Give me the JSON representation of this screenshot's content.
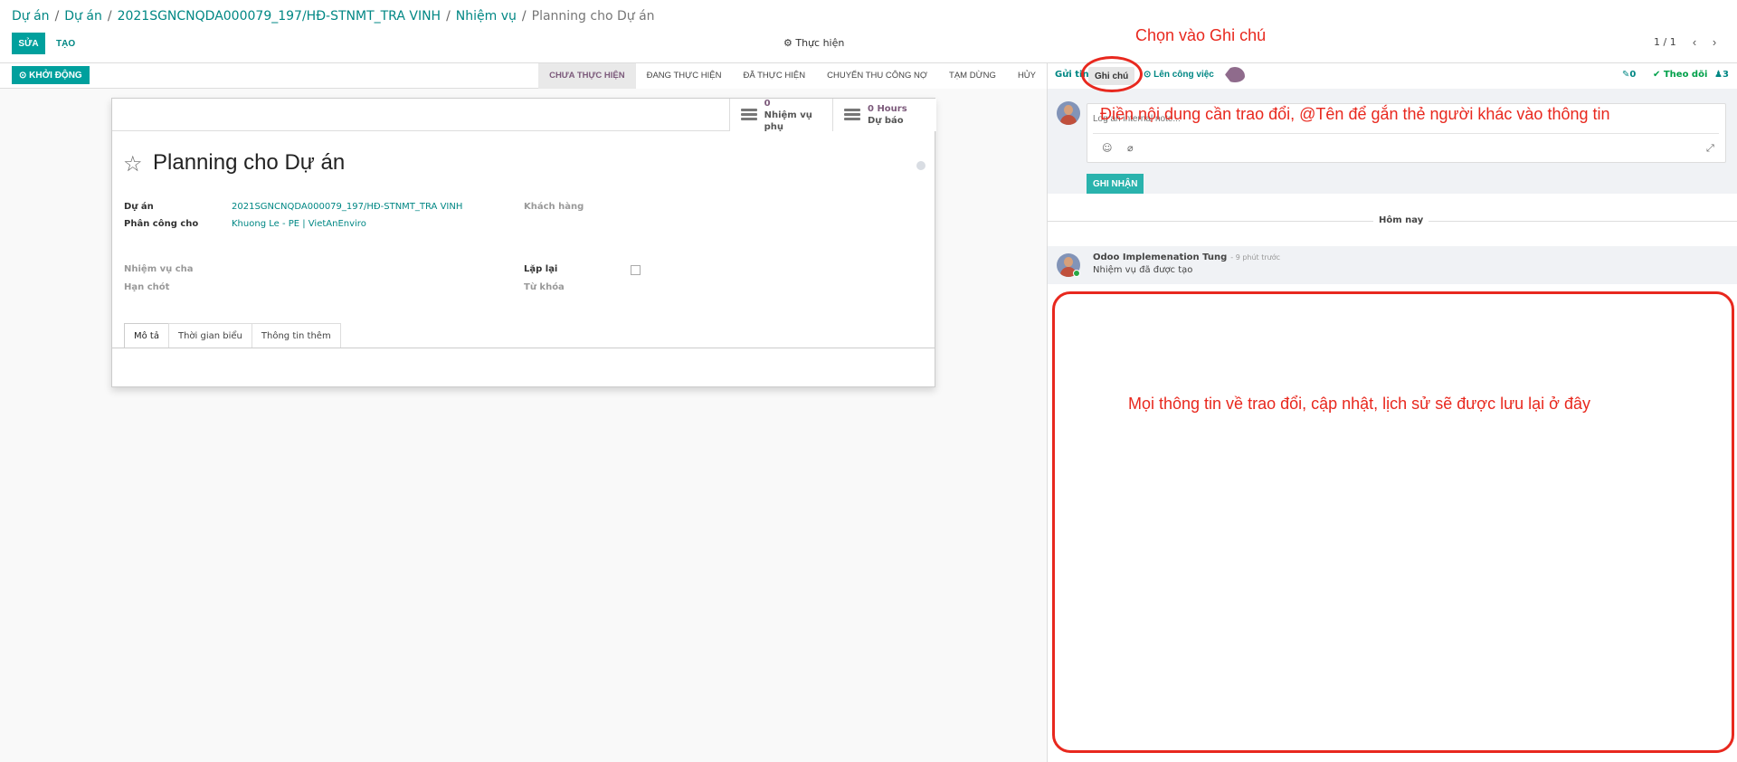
{
  "breadcrumb": {
    "items": [
      "Dự án",
      "Dự án",
      "2021SGNCNQDA000079_197/HĐ-STNMT_TRA VINH",
      "Nhiệm vụ"
    ],
    "current": "Planning cho Dự án"
  },
  "toolbar": {
    "edit_label": "SỬA",
    "create_label": "TẠO",
    "action_label": "⚙ Thực hiện",
    "pager": "1 / 1"
  },
  "statusbar": {
    "start_label": "⊙ KHỞI ĐỘNG",
    "stages": [
      "CHƯA THỰC HIỆN",
      "ĐANG THỰC HIỆN",
      "ĐÃ THỰC HIỆN",
      "CHUYỂN THU CÔNG NỢ",
      "TẠM DỪNG",
      "HỦY"
    ],
    "active_stage": "CHƯA THỰC HIỆN"
  },
  "stats": {
    "subtasks_value": "0",
    "subtasks_label": "Nhiệm vụ phụ",
    "forecast_value": "0  Hours",
    "forecast_label": "Dự báo"
  },
  "form": {
    "title": "Planning cho Dự án",
    "project_label": "Dự án",
    "project_value": "2021SGNCNQDA000079_197/HĐ-STNMT_TRA VINH",
    "assignee_label": "Phân công cho",
    "assignee_value": "Khuong Le - PE | VietAnEnviro",
    "customer_label": "Khách hàng",
    "parent_label": "Nhiệm vụ cha",
    "deadline_label": "Hạn chót",
    "recurring_label": "Lặp lại",
    "tags_label": "Từ khóa",
    "tabs": [
      "Mô tả",
      "Thời gian biểu",
      "Thông tin thêm"
    ]
  },
  "chatter": {
    "send_message": "Gửi tin",
    "log_note": "Ghi chú",
    "schedule_activity": "⊙ Lên công việc",
    "attachments": "0",
    "follow": "✔ Theo dõi",
    "followers": "3",
    "composer_placeholder": "Log an internal note...",
    "submit_label": "GHI NHẬN",
    "today_label": "Hôm nay",
    "message_author": "Odoo Implemenation Tung",
    "message_time": "- 9 phút trước",
    "message_body": "Nhiệm vụ đã được tạo"
  },
  "annotations": {
    "choose_note": "Chọn vào Ghi chú",
    "fill_content": "Điền nội dung cần trao đổi, @Tên để gắn thẻ người khác vào thông tin",
    "history_info": "Mọi thông tin về trao đổi, cập nhật, lịch sử sẽ được lưu lại ở đây",
    "color": "#e8281e"
  }
}
